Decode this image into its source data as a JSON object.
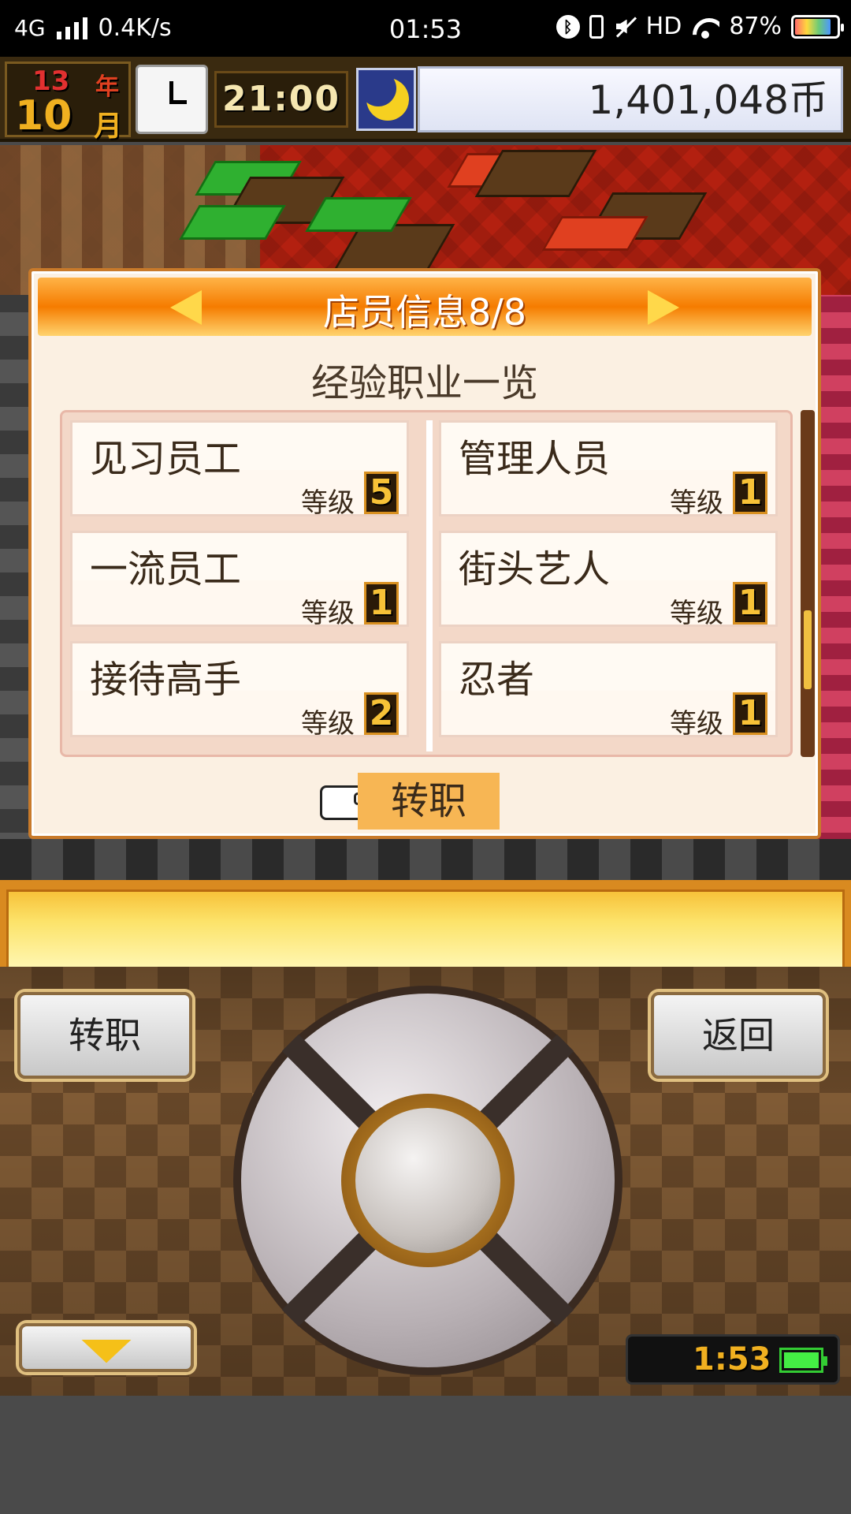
{
  "status_bar": {
    "network": "4G",
    "speed": "0.4K/s",
    "time": "01:53",
    "hd": "HD",
    "battery_percent": "87%"
  },
  "hud": {
    "year": "13",
    "year_unit": "年",
    "month": "10",
    "month_unit": "月",
    "game_time": "21:00",
    "money": "1,401,048币"
  },
  "dialog": {
    "title": "店员信息8/8",
    "subtitle": "经验职业一览",
    "level_label": "等级",
    "jobs": [
      {
        "name": "见习员工",
        "level": "5"
      },
      {
        "name": "管理人员",
        "level": "1"
      },
      {
        "name": "一流员工",
        "level": "1"
      },
      {
        "name": "街头艺人",
        "level": "1"
      },
      {
        "name": "接待高手",
        "level": "2"
      },
      {
        "name": "忍者",
        "level": "1"
      }
    ],
    "action_label": "转职"
  },
  "controller": {
    "left_button": "转职",
    "right_button": "返回",
    "clock": "1:53"
  },
  "icons": {
    "dpad": "dpad-icon",
    "hand": "pointing-hand-icon",
    "moon": "moon-icon",
    "clock": "clock-icon"
  }
}
